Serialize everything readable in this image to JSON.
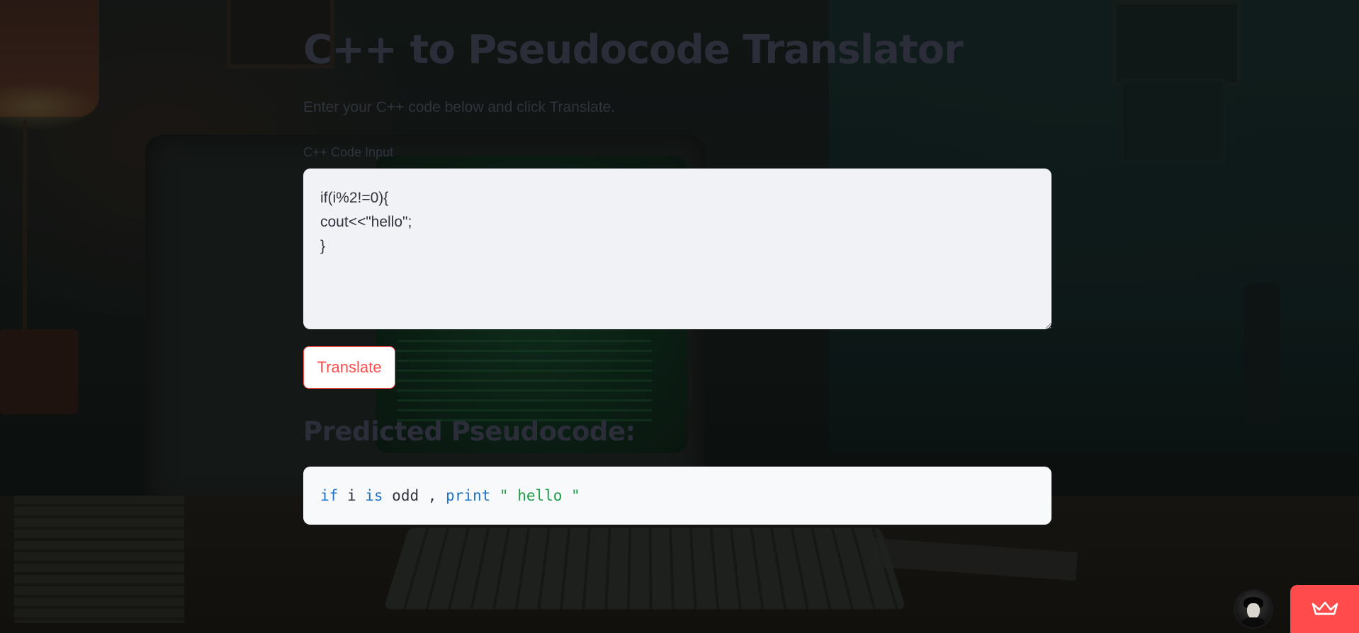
{
  "app": {
    "title": "C++ to Pseudocode Translator",
    "subtitle": "Enter your C++ code below and click Translate."
  },
  "input": {
    "label": "C++ Code Input",
    "value": "if(i%2!=0){\ncout<<\"hello\";\n}"
  },
  "translate_button": {
    "label": "Translate"
  },
  "output": {
    "heading": "Predicted Pseudocode:",
    "tokens": {
      "t0": "if",
      "t1": " i ",
      "t2": "is",
      "t3": " odd , ",
      "t4": "print",
      "t5": " \" hello \""
    }
  },
  "widgets": {
    "avatar_icon": "user-avatar-icon",
    "badge_icon": "crown-icon"
  },
  "colors": {
    "accent": "#ff4b4b",
    "keyword": "#1f73c9",
    "string": "#1b9e45",
    "input_bg": "#f0f2f6",
    "output_bg": "#f8f9fb",
    "heading_text": "#2b2e38"
  }
}
